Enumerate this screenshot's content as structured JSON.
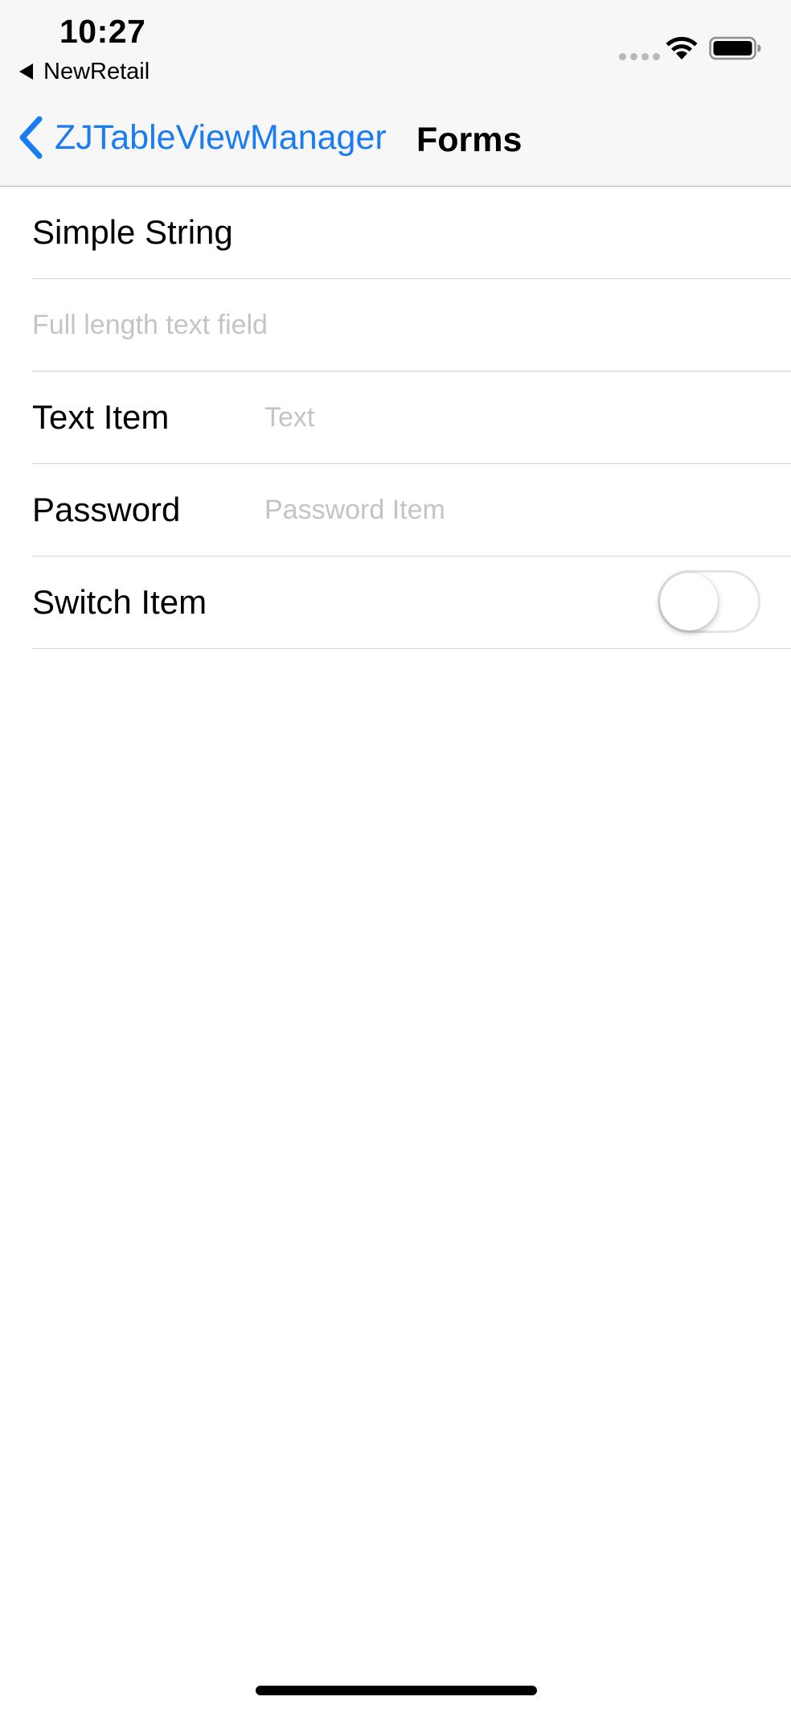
{
  "status_bar": {
    "time": "10:27",
    "back_app": "NewRetail",
    "signal": "signal-dots-icon",
    "wifi": "wifi-icon",
    "battery": "battery-icon"
  },
  "nav": {
    "back_label": "ZJTableViewManager",
    "back_icon": "chevron-left-icon",
    "title": "Forms",
    "tint_color": "#1b7cf2"
  },
  "rows": [
    {
      "type": "label",
      "label": "Simple String"
    },
    {
      "type": "full_text_field",
      "value": "",
      "placeholder": "Full length text field"
    },
    {
      "type": "text_field",
      "label": "Text Item",
      "value": "",
      "placeholder": "Text"
    },
    {
      "type": "password_field",
      "label": "Password",
      "value": "",
      "placeholder": "Password Item"
    },
    {
      "type": "switch",
      "label": "Switch Item",
      "on": false
    }
  ]
}
